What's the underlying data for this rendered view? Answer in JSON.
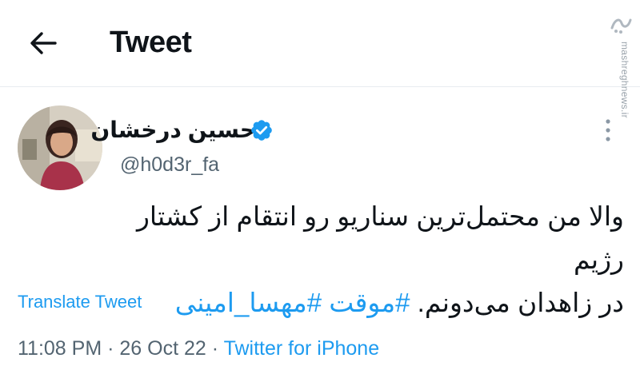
{
  "header": {
    "title": "Tweet",
    "back_icon": "arrow-left-icon"
  },
  "watermark": {
    "text": "mashreghnews.ir"
  },
  "author": {
    "display_name": "حسین درخشان",
    "handle": "@h0d3r_fa",
    "verified": true
  },
  "tweet": {
    "line1": "والا من محتمل‌ترین سناریو رو انتقام از کشتار رژیم",
    "line2_text": "در زاهدان می‌دونم.",
    "hashtags": [
      "#موقت",
      "#مهسا_امینی"
    ]
  },
  "translate_label": "Translate Tweet",
  "meta": {
    "time": "11:08 PM",
    "separator": "·",
    "date": "26 Oct 22",
    "source": "Twitter for iPhone"
  },
  "colors": {
    "accent": "#1d9bf0",
    "text": "#0f1419",
    "secondary": "#536471",
    "divider": "#e7ecf0"
  }
}
